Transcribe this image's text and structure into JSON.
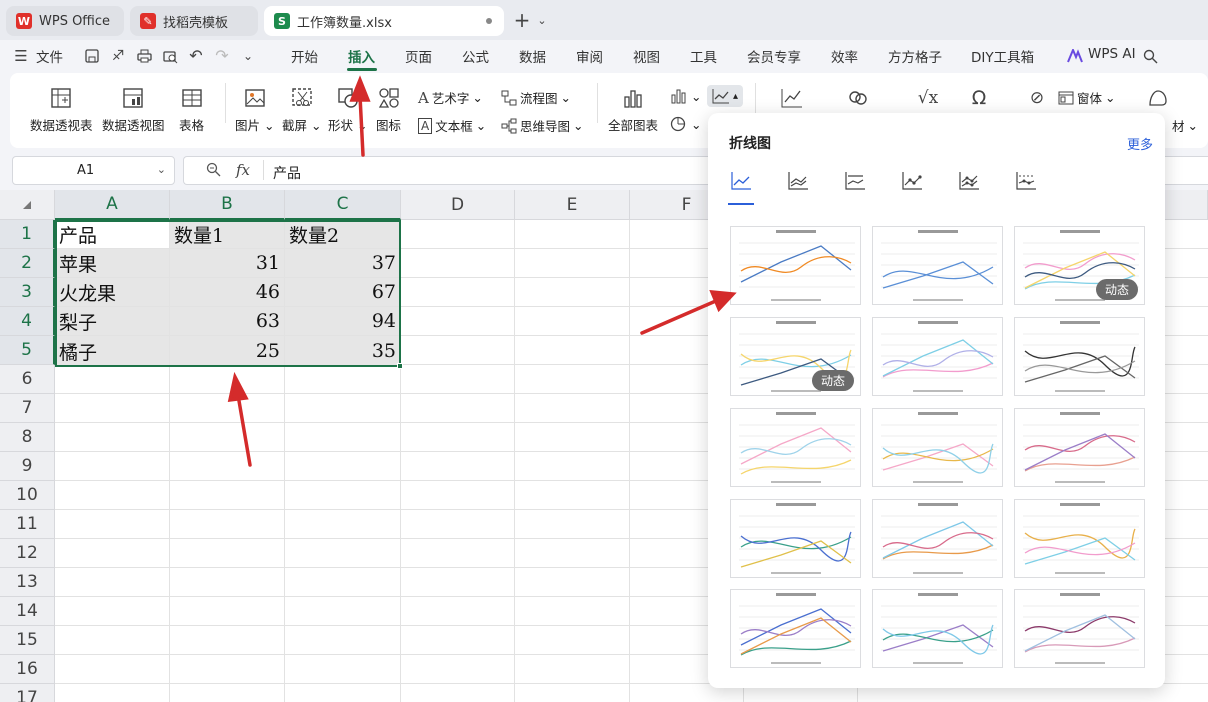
{
  "tabs": [
    {
      "label": "WPS Office",
      "logo": "W"
    },
    {
      "label": "找稻壳模板",
      "logo": "✎"
    },
    {
      "label": "工作簿数量.xlsx",
      "logo": "S"
    }
  ],
  "menu": {
    "file": "文件",
    "items": [
      "开始",
      "插入",
      "页面",
      "公式",
      "数据",
      "审阅",
      "视图",
      "工具",
      "会员专享",
      "效率",
      "方方格子",
      "DIY工具箱"
    ],
    "active": "插入",
    "ai": "WPS AI"
  },
  "ribbon": {
    "pivot_table": "数据透视表",
    "pivot_chart": "数据透视图",
    "table": "表格",
    "picture": "图片",
    "screenshot": "截屏",
    "shape": "形状",
    "icon": "图标",
    "wordart": "艺术字",
    "textbox": "文本框",
    "flowchart": "流程图",
    "mindmap": "思维导图",
    "all_charts": "全部图表",
    "window": "窗体",
    "more_tail": "材"
  },
  "formula_bar": {
    "name_box": "A1",
    "fx": "fx",
    "content": "产品"
  },
  "sheet": {
    "columns": [
      "A",
      "B",
      "C",
      "D",
      "E",
      "F"
    ],
    "rows": [
      "1",
      "2",
      "3",
      "4",
      "5",
      "6",
      "7",
      "8",
      "9",
      "10",
      "11",
      "12",
      "13",
      "14",
      "15",
      "16",
      "17"
    ],
    "headers": [
      "产品",
      "数量1",
      "数量2"
    ],
    "data": [
      [
        "苹果",
        "31",
        "37"
      ],
      [
        "火龙果",
        "46",
        "67"
      ],
      [
        "梨子",
        "63",
        "94"
      ],
      [
        "橘子",
        "25",
        "35"
      ]
    ]
  },
  "chart_panel": {
    "title": "折线图",
    "more": "更多",
    "badge": "动态"
  },
  "colors": {
    "green": "#1d7348",
    "blue": "#2b5fd9",
    "red": "#d42b2b"
  }
}
